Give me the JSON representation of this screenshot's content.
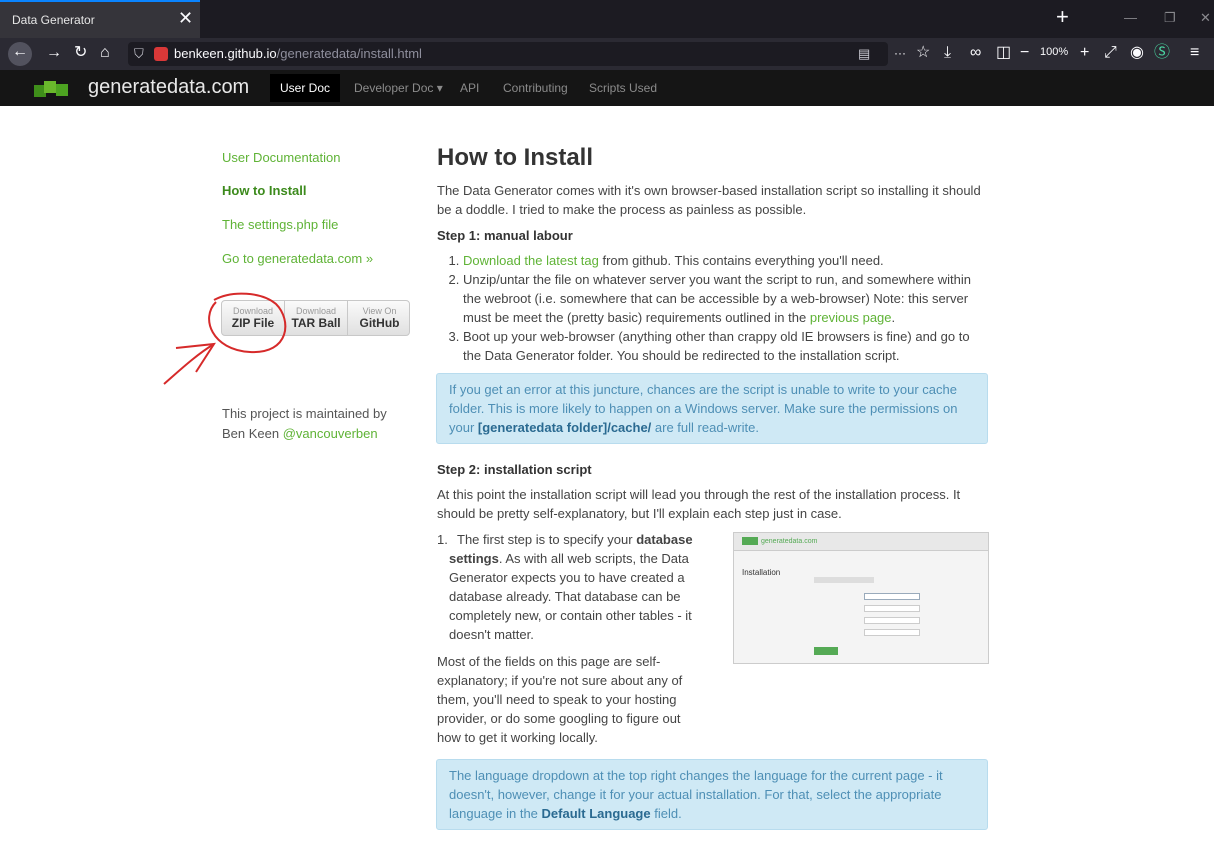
{
  "browser": {
    "tab_title": "Data Generator",
    "url_domain": "benkeen.github.io",
    "url_path": "/generatedata/install.html",
    "zoom": "100%"
  },
  "site": {
    "logo": "generatedata.com",
    "nav": [
      "User Doc",
      "Developer Doc ▾",
      "API",
      "Contributing",
      "Scripts Used"
    ]
  },
  "sidebar": {
    "links": [
      "User Documentation",
      "How to Install",
      "The settings.php file",
      "Go to generatedata.com »"
    ],
    "downloads": [
      {
        "small": "Download",
        "big": "ZIP File"
      },
      {
        "small": "Download",
        "big": "TAR Ball"
      },
      {
        "small": "View On",
        "big": "GitHub"
      }
    ],
    "maintained_text": "This project is maintained by",
    "maintainer": "Ben Keen",
    "maintainer_handle": "@vancouverben"
  },
  "content": {
    "title": "How to Install",
    "intro": "The Data Generator comes with it's own browser-based installation script so installing it should be a doddle. I tried to make the process as painless as possible.",
    "step1_heading": "Step 1: manual labour",
    "step1_item1_link": "Download the latest tag",
    "step1_item1_rest": " from github. This contains everything you'll need.",
    "step1_item2_a": "Unzip/untar the file on whatever server you want the script to run, and somewhere within the webroot (i.e. somewhere that can be accessible by a web-browser) Note: this server must be meet the (pretty basic) requirements outlined in the ",
    "step1_item2_link": "previous page",
    "step1_item2_b": ".",
    "step1_item3": "Boot up your web-browser (anything other than crappy old IE browsers is fine) and go to the Data Generator folder. You should be redirected to the installation script.",
    "alert1_a": "If you get an error at this juncture, chances are the script is unable to write to your cache folder. This is more likely to happen on a Windows server. Make sure the permissions on your ",
    "alert1_bold": "[generatedata folder]/cache/",
    "alert1_b": " are full read-write.",
    "step2_heading": "Step 2: installation script",
    "step2_intro": "At this point the installation script will lead you through the rest of the installation process. It should be pretty self-explanatory, but I'll explain each step just in case.",
    "step2_item1_a": "The first step is to specify your ",
    "step2_item1_bold": "database settings",
    "step2_item1_b": ". As with all web scripts, the Data Generator expects you to have created a database already. That database can be completely new, or contain other tables - it doesn't matter.",
    "step2_item1_p2": "Most of the fields on this page are self-explanatory; if you're not sure about any of them, you'll need to speak to your hosting provider, or do some googling to figure out how to get it working locally.",
    "alert2_a": "The language dropdown at the top right changes the language for the current page - it doesn't, however, change it for your actual installation. For that, select the appropriate language in the ",
    "alert2_bold": "Default Language",
    "alert2_b": " field.",
    "thumb_logo": "generatedata.com",
    "thumb_title": "Installation"
  }
}
